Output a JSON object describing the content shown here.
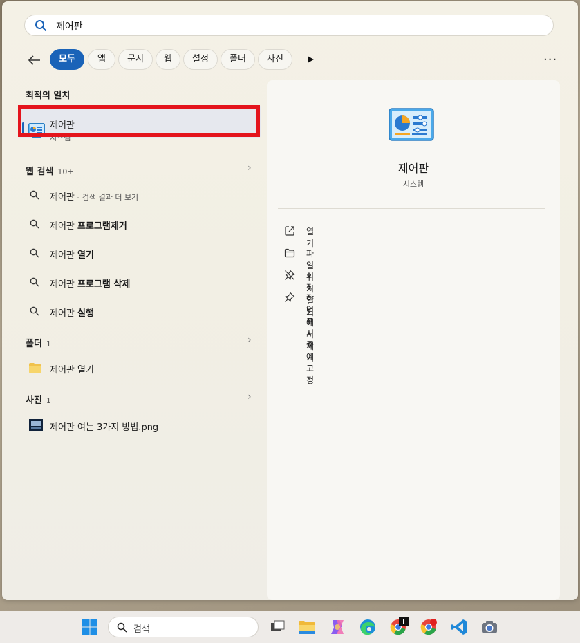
{
  "search": {
    "query": "제어판"
  },
  "filters": [
    {
      "label": "모두",
      "active": true
    },
    {
      "label": "앱"
    },
    {
      "label": "문서"
    },
    {
      "label": "웹"
    },
    {
      "label": "설정"
    },
    {
      "label": "폴더"
    },
    {
      "label": "사진"
    }
  ],
  "more_label": "···",
  "best_match": {
    "section_title": "최적의 일치",
    "name": "제어판",
    "subtitle": "시스템"
  },
  "web_search": {
    "section_title": "웹 검색",
    "count": "10+",
    "items": [
      {
        "prefix": "제어판",
        "bold": "",
        "suffix": " - 검색 결과 더 보기"
      },
      {
        "prefix": "제어판 ",
        "bold": "프로그램제거",
        "suffix": ""
      },
      {
        "prefix": "제어판 ",
        "bold": "열기",
        "suffix": ""
      },
      {
        "prefix": "제어판 ",
        "bold": "프로그램 삭제",
        "suffix": ""
      },
      {
        "prefix": "제어판 ",
        "bold": "실행",
        "suffix": ""
      }
    ]
  },
  "folders": {
    "section_title": "폴더",
    "count": "1",
    "items": [
      {
        "label": "제어판 열기"
      }
    ]
  },
  "photos": {
    "section_title": "사진",
    "count": "1",
    "items": [
      {
        "label": "제어판 여는 3가지 방법.png"
      }
    ]
  },
  "detail": {
    "title": "제어판",
    "subtitle": "시스템",
    "actions": [
      {
        "label": "열기",
        "icon": "open-external-icon"
      },
      {
        "label": "파일 위치 열기",
        "icon": "folder-icon"
      },
      {
        "label": "시작 화면에서 제거",
        "icon": "unpin-icon"
      },
      {
        "label": "작업 표시줄에 고정",
        "icon": "pin-icon"
      }
    ]
  },
  "taskbar": {
    "search_placeholder": "검색"
  },
  "colors": {
    "accent": "#1a63b8",
    "highlight_box": "#e4141c"
  }
}
